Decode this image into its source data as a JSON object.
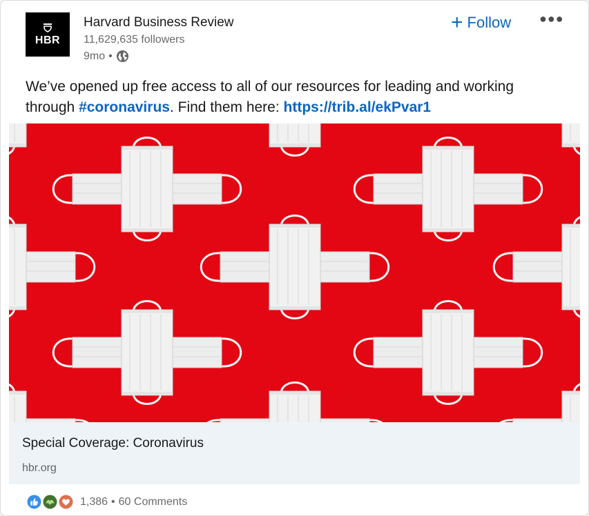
{
  "post": {
    "author": {
      "logo_text": "HBR",
      "name": "Harvard Business Review",
      "followers": "11,629,635 followers",
      "time": "9mo",
      "visibility_icon": "globe-icon"
    },
    "follow_label": "Follow",
    "more_icon": "ellipsis-icon",
    "text_before": "We’ve opened up free access to all of our resources for leading and working through ",
    "hashtag": "#coronavirus",
    "text_middle": ". Find them here: ",
    "url": "https://trib.al/ekPvar1",
    "image": {
      "description": "face-masks-pattern",
      "background_color": "#e30613"
    },
    "preview": {
      "title": "Special Coverage: Coronavirus",
      "source": "hbr.org"
    },
    "social": {
      "reaction_icons": [
        "like-icon",
        "support-icon",
        "love-icon"
      ],
      "reactions_count": "1,386",
      "comments": "60 Comments"
    }
  }
}
